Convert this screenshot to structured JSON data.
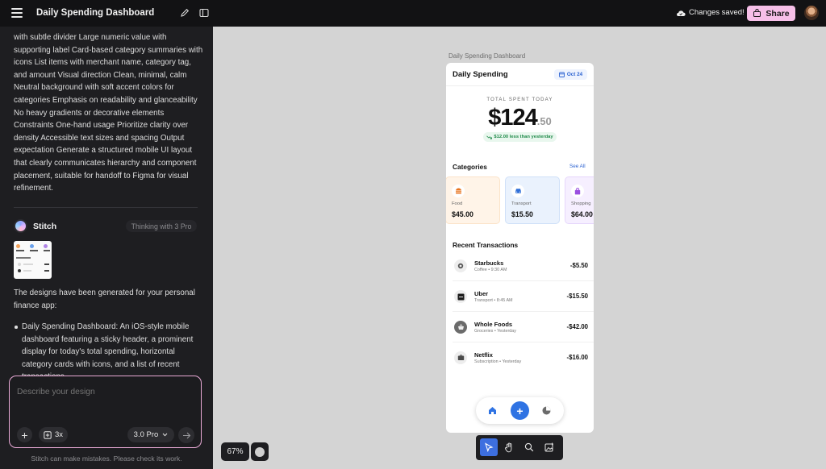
{
  "topbar": {
    "title": "Daily Spending Dashboard",
    "saved_status": "Changes saved!",
    "share_label": "Share"
  },
  "chat": {
    "prompt_text": "with subtle divider Large numeric value with supporting label Card-based category summaries with icons List items with merchant name, category tag, and amount Visual direction Clean, minimal, calm Neutral background with soft accent colors for categories Emphasis on readability and glanceability No heavy gradients or decorative elements Constraints One-hand usage Prioritize clarity over density Accessible text sizes and spacing Output expectation Generate a structured mobile UI layout that clearly communicates hierarchy and component placement, suitable for handoff to Figma for visual refinement.",
    "agent_name": "Stitch",
    "agent_status": "Thinking with 3 Pro",
    "response_intro": "The designs have been generated for your personal finance app:",
    "response_bullet": "Daily Spending Dashboard: An iOS-style mobile dashboard featuring a sticky header, a prominent display for today's total spending, horizontal category cards with icons, and a list of recent transactions."
  },
  "composer": {
    "placeholder": "Describe your design",
    "multiplier_label": "3x",
    "model_label": "3.0 Pro",
    "disclaimer": "Stitch can make mistakes. Please check its work."
  },
  "canvas": {
    "frame_label": "Daily Spending Dashboard",
    "zoom": "67%"
  },
  "app": {
    "title": "Daily Spending",
    "date_chip": "Oct 24",
    "total_label": "TOTAL SPENT TODAY",
    "total_whole": "$124",
    "total_cents": ".50",
    "delta_text": "$12.00 less than yesterday",
    "categories_heading": "Categories",
    "see_all": "See All",
    "categories": [
      {
        "name": "Food",
        "amount": "$45.00",
        "bg": "#fff4e8",
        "accent": "#e8741f",
        "icon": "food-icon"
      },
      {
        "name": "Transport",
        "amount": "$15.50",
        "bg": "#eaf2fd",
        "accent": "#2f6fd8",
        "icon": "car-icon"
      },
      {
        "name": "Shopping",
        "amount": "$64.00",
        "bg": "#f6efff",
        "accent": "#9a4fe0",
        "icon": "shopping-bag-icon"
      }
    ],
    "transactions_heading": "Recent Transactions",
    "transactions": [
      {
        "merchant": "Starbucks",
        "meta": "Coffee • 9:30 AM",
        "amount": "-$5.50",
        "icon": "coffee-icon"
      },
      {
        "merchant": "Uber",
        "meta": "Transport • 8:45 AM",
        "amount": "-$15.50",
        "icon": "uber-icon"
      },
      {
        "merchant": "Whole Foods",
        "meta": "Groceries • Yesterday",
        "amount": "-$42.00",
        "icon": "basket-icon"
      },
      {
        "merchant": "Netflix",
        "meta": "Subscription • Yesterday",
        "amount": "-$16.00",
        "icon": "tv-icon"
      }
    ]
  },
  "colors": {
    "share": "#f6bfe8",
    "accent_blue": "#2f73e3",
    "positive": "#1f8a49"
  }
}
